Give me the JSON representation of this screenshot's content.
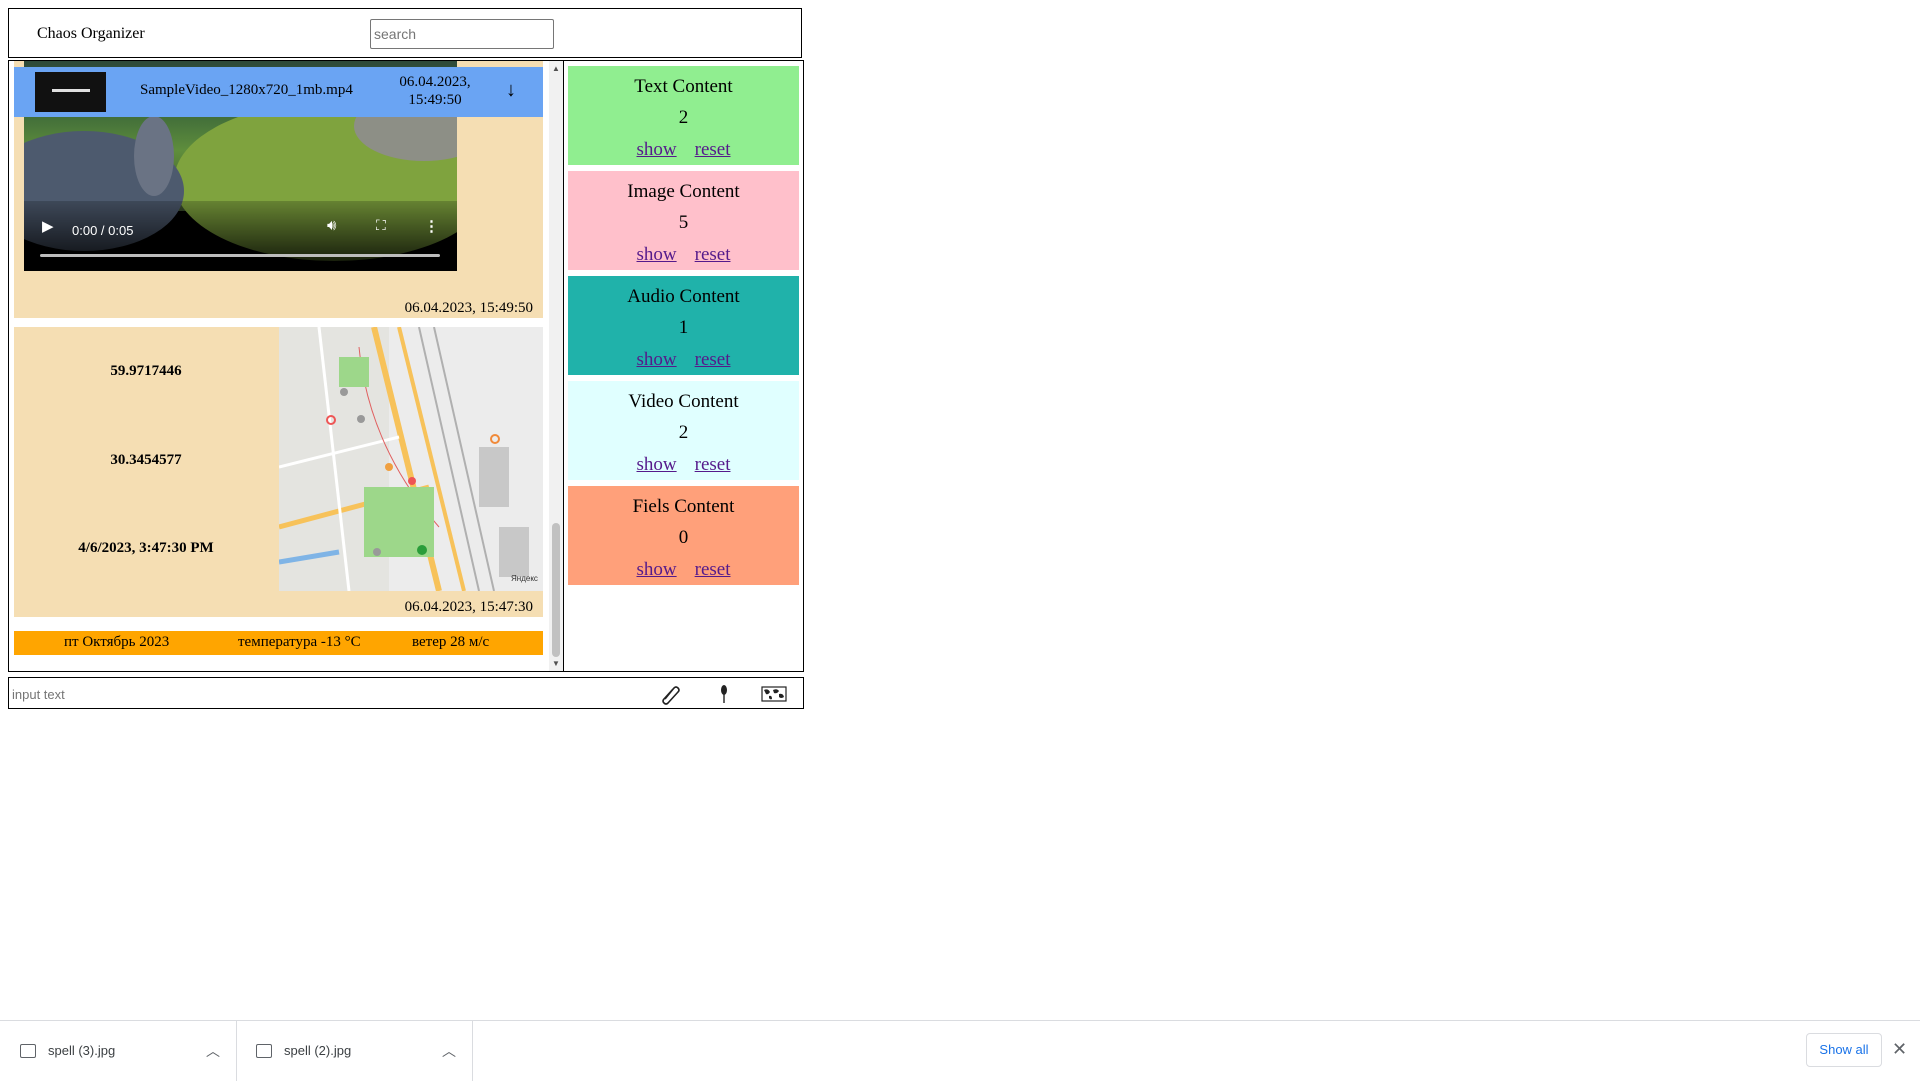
{
  "header": {
    "title": "Chaos Organizer",
    "search_placeholder": "search"
  },
  "feed": {
    "video_message": {
      "player_time": "0:00 / 0:05",
      "date": "06.04.2023, 15:49:50"
    },
    "file_bar": {
      "file_name": "SampleVideo_1280x720_1mb.mp4",
      "date_line1": "06.04.2023,",
      "date_line2": "15:49:50",
      "download_glyph": "↓"
    },
    "geo_message": {
      "latitude": "59.9717446",
      "longitude": "30.3454577",
      "timestamp": "4/6/2023, 3:47:30 PM",
      "date": "06.04.2023, 15:47:30"
    },
    "weather": {
      "date": "пт Октябрь 2023",
      "temperature": "температура -13 °C",
      "wind": "ветер 28 м/с"
    }
  },
  "stats": {
    "cards": [
      {
        "title": "Text Content",
        "count": "2",
        "show": "show",
        "reset": "reset",
        "color": "#90ee90"
      },
      {
        "title": "Image Content",
        "count": "5",
        "show": "show",
        "reset": "reset",
        "color": "#ffc0cb"
      },
      {
        "title": "Audio Content",
        "count": "1",
        "show": "show",
        "reset": "reset",
        "color": "#20b2aa"
      },
      {
        "title": "Video Content",
        "count": "2",
        "show": "show",
        "reset": "reset",
        "color": "#e0ffff"
      },
      {
        "title": "Fiels Content",
        "count": "0",
        "show": "show",
        "reset": "reset",
        "color": "#ffa07a"
      }
    ]
  },
  "input_bar": {
    "placeholder": "input text",
    "icons": [
      "paperclip-icon",
      "microphone-icon",
      "world-map-icon"
    ]
  },
  "downloads": {
    "items": [
      {
        "name": "spell (3).jpg"
      },
      {
        "name": "spell (2).jpg"
      }
    ],
    "show_all": "Show all",
    "close_glyph": "✕"
  }
}
